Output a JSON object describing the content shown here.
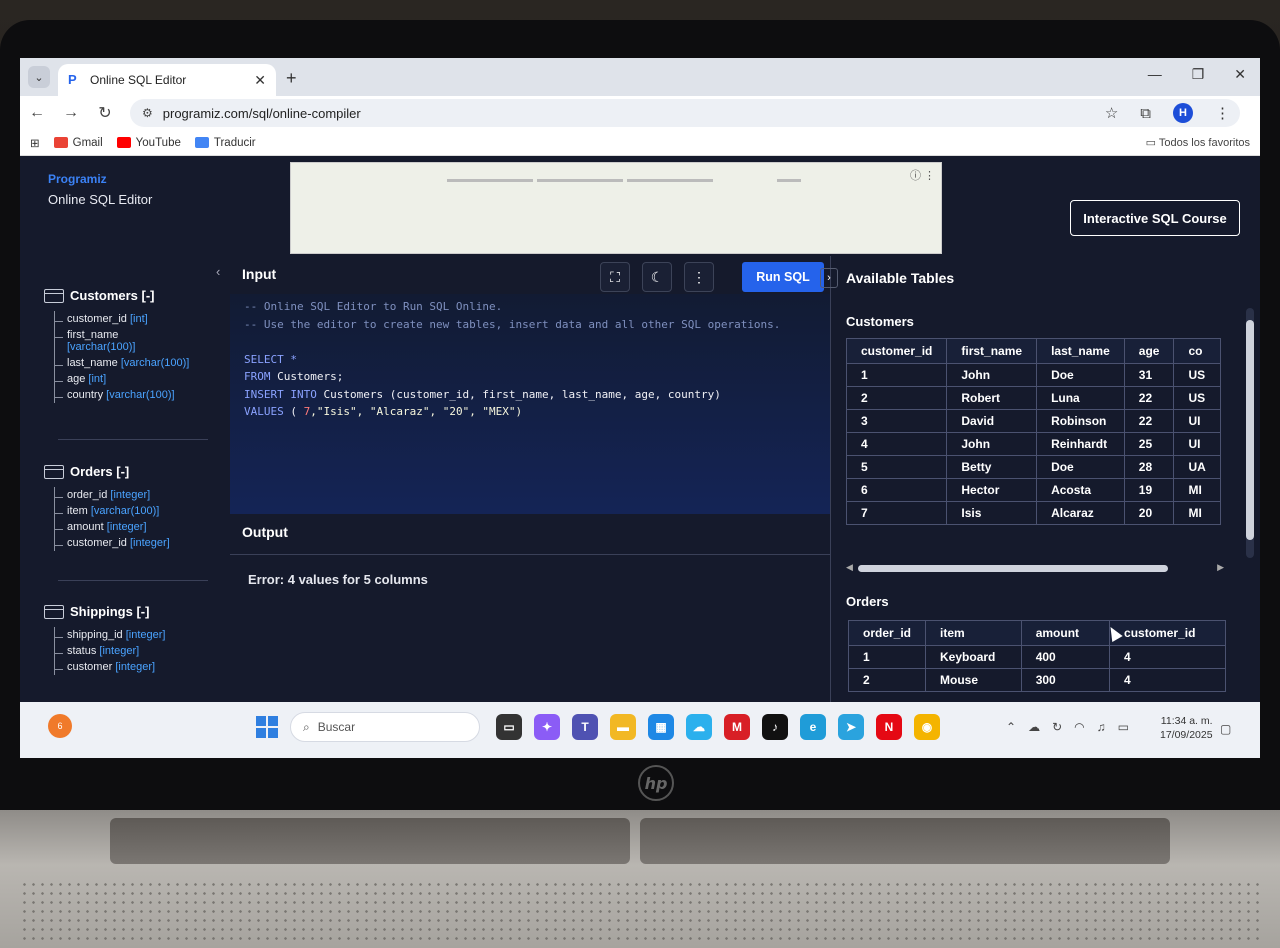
{
  "browser": {
    "tab_title": "Online SQL Editor",
    "tab_close": "✕",
    "new_tab": "+",
    "url": "programiz.com/sql/online-compiler",
    "bookmarks": [
      "Gmail",
      "YouTube",
      "Traducir"
    ],
    "all_bookmarks": "Todos los favoritos",
    "profile_initial": "H"
  },
  "header": {
    "logo": "Programiz",
    "app_name": "Online SQL Editor",
    "course_button": "Interactive SQL Course"
  },
  "sidebar": {
    "tables": [
      {
        "title": "Customers [-]",
        "columns": [
          {
            "name": "customer_id",
            "type": "[int]"
          },
          {
            "name": "first_name",
            "type": "[varchar(100)]"
          },
          {
            "name": "last_name",
            "type": "[varchar(100)]"
          },
          {
            "name": "age",
            "type": "[int]"
          },
          {
            "name": "country",
            "type": "[varchar(100)]"
          }
        ]
      },
      {
        "title": "Orders [-]",
        "columns": [
          {
            "name": "order_id",
            "type": "[integer]"
          },
          {
            "name": "item",
            "type": "[varchar(100)]"
          },
          {
            "name": "amount",
            "type": "[integer]"
          },
          {
            "name": "customer_id",
            "type": "[integer]"
          }
        ]
      },
      {
        "title": "Shippings [-]",
        "columns": [
          {
            "name": "shipping_id",
            "type": "[integer]"
          },
          {
            "name": "status",
            "type": "[integer]"
          },
          {
            "name": "customer",
            "type": "[integer]"
          }
        ]
      }
    ]
  },
  "editor": {
    "input_label": "Input",
    "run_button": "Run SQL",
    "comment1": "-- Online SQL Editor to Run SQL Online.",
    "comment2": "-- Use the editor to create new tables, insert data and all other SQL operations.",
    "select_kw": "SELECT",
    "select_rest": " *",
    "from_kw": "FROM",
    "from_rest": " Customers;",
    "insert_kw": "INSERT INTO",
    "insert_rest": " Customers (customer_id, first_name,  last_name, age, country)",
    "values_kw": "VALUES",
    "values_open": " ( ",
    "values_num": "7",
    "values_rest": ",\"Isis\", \"Alcaraz\", \"20\", \"MEX\")"
  },
  "output": {
    "label": "Output",
    "error": "Error: 4 values for 5 columns"
  },
  "available": {
    "title": "Available Tables",
    "customers": {
      "title": "Customers",
      "headers": [
        "customer_id",
        "first_name",
        "last_name",
        "age",
        "co"
      ],
      "rows": [
        [
          "1",
          "John",
          "Doe",
          "31",
          "US"
        ],
        [
          "2",
          "Robert",
          "Luna",
          "22",
          "US"
        ],
        [
          "3",
          "David",
          "Robinson",
          "22",
          "UI"
        ],
        [
          "4",
          "John",
          "Reinhardt",
          "25",
          "UI"
        ],
        [
          "5",
          "Betty",
          "Doe",
          "28",
          "UA"
        ],
        [
          "6",
          "Hector",
          "Acosta",
          "19",
          "MI"
        ],
        [
          "7",
          "Isis",
          "Alcaraz",
          "20",
          "MI"
        ]
      ]
    },
    "orders": {
      "title": "Orders",
      "headers": [
        "order_id",
        "item",
        "amount",
        "customer_id"
      ],
      "rows": [
        [
          "1",
          "Keyboard",
          "400",
          "4"
        ],
        [
          "2",
          "Mouse",
          "300",
          "4"
        ]
      ]
    }
  },
  "taskbar": {
    "weather_badge": "6",
    "search_placeholder": "Buscar",
    "time": "11:34 a. m.",
    "date": "17/09/2025"
  },
  "hardware": {
    "brand": "hp"
  }
}
